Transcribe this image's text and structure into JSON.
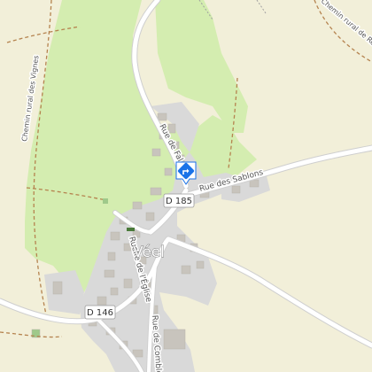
{
  "map": {
    "place_name": "Véel",
    "road_labels": {
      "rue_fal": "Rue de Fal",
      "rue_sablons": "Rue des Sablons",
      "ruelle_eglise": "Ruelle de l'Église",
      "rue_combles": "Rue de Combles",
      "chemin_vignes": "Chemin rural des Vignes",
      "chemin_remond": "Chemin rural de Rémond C"
    },
    "route_shields": {
      "d185": "D 185",
      "d146": "D 146"
    },
    "marker": {
      "icon": "directions-icon",
      "color": "#1a73e8"
    },
    "colors": {
      "background": "#f2efd9",
      "forest": "#d4edb0",
      "residential": "#d9d9d9",
      "building": "#c8c4bd",
      "road": "#ffffff",
      "track": "#b5834f"
    }
  }
}
